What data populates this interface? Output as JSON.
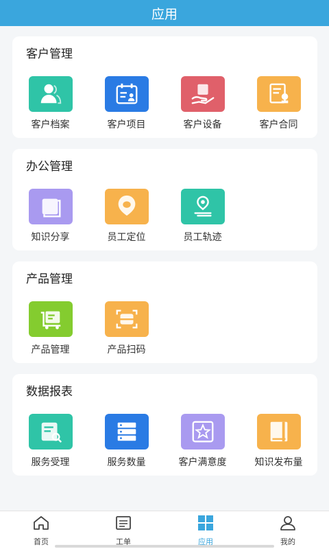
{
  "header": {
    "title": "应用"
  },
  "colors": {
    "accent": "#3aa6dd",
    "teal": "#2fc4a7",
    "blue": "#2a7be4",
    "red": "#e0606a",
    "orange": "#f7b24c",
    "purple": "#a99af0",
    "green": "#84cc2f"
  },
  "sections": [
    {
      "title": "客户管理",
      "items": [
        {
          "label": "客户档案",
          "icon": "customer-profile-icon",
          "color": "#2fc4a7"
        },
        {
          "label": "客户项目",
          "icon": "customer-project-icon",
          "color": "#2a7be4"
        },
        {
          "label": "客户设备",
          "icon": "customer-device-icon",
          "color": "#e0606a"
        },
        {
          "label": "客户合同",
          "icon": "customer-contract-icon",
          "color": "#f7b24c"
        }
      ]
    },
    {
      "title": "办公管理",
      "items": [
        {
          "label": "知识分享",
          "icon": "knowledge-share-icon",
          "color": "#a99af0"
        },
        {
          "label": "员工定位",
          "icon": "staff-location-icon",
          "color": "#f7b24c"
        },
        {
          "label": "员工轨迹",
          "icon": "staff-track-icon",
          "color": "#2fc4a7"
        }
      ]
    },
    {
      "title": "产品管理",
      "items": [
        {
          "label": "产品管理",
          "icon": "product-manage-icon",
          "color": "#84cc2f"
        },
        {
          "label": "产品扫码",
          "icon": "product-scan-icon",
          "color": "#f7b24c"
        }
      ]
    },
    {
      "title": "数据报表",
      "items": [
        {
          "label": "服务受理",
          "icon": "service-accept-icon",
          "color": "#2fc4a7"
        },
        {
          "label": "服务数量",
          "icon": "service-count-icon",
          "color": "#2a7be4"
        },
        {
          "label": "客户满意度",
          "icon": "satisfaction-icon",
          "color": "#a99af0"
        },
        {
          "label": "知识发布量",
          "icon": "knowledge-publish-icon",
          "color": "#f7b24c"
        }
      ]
    }
  ],
  "tabbar": {
    "tabs": [
      {
        "label": "首页",
        "icon": "home-icon",
        "active": false
      },
      {
        "label": "工单",
        "icon": "work-order-icon",
        "active": false
      },
      {
        "label": "应用",
        "icon": "apps-icon",
        "active": true
      },
      {
        "label": "我的",
        "icon": "profile-icon",
        "active": false
      }
    ]
  }
}
